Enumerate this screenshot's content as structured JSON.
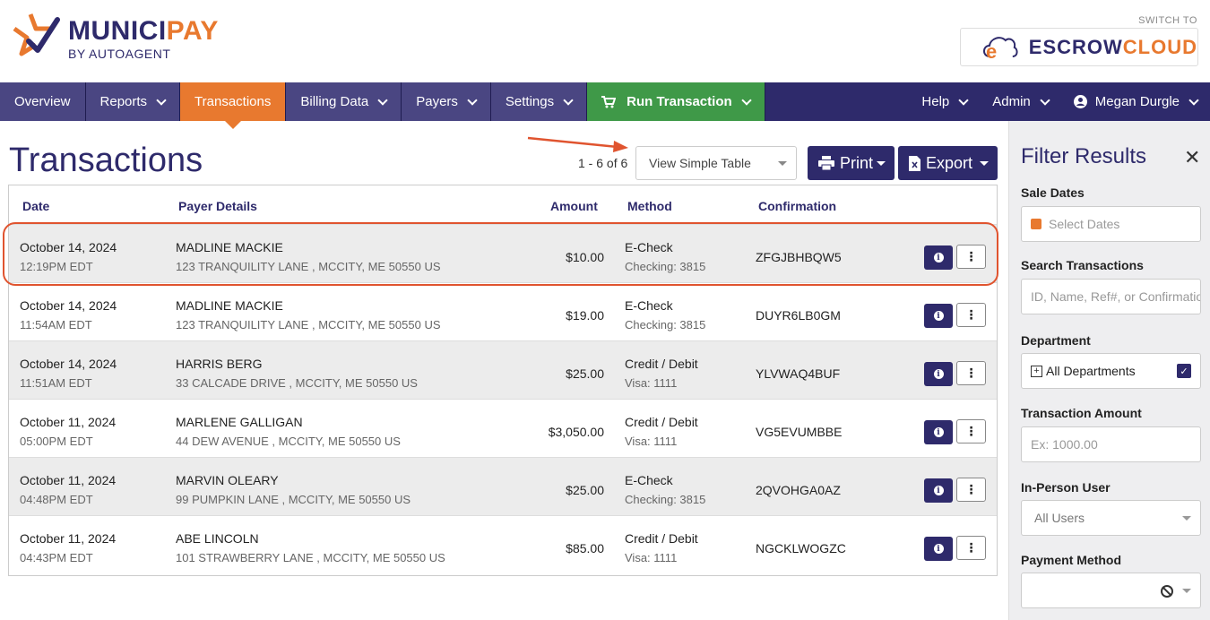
{
  "header": {
    "logo_main_a": "MUNICI",
    "logo_main_b": "PAY",
    "logo_sub": "BY AUTOAGENT",
    "switch_to": "SWITCH TO",
    "escrow_a": "ESCROW",
    "escrow_b": "CLOUD"
  },
  "nav": {
    "overview": "Overview",
    "reports": "Reports",
    "transactions": "Transactions",
    "billing": "Billing Data",
    "payers": "Payers",
    "settings": "Settings",
    "run": "Run Transaction",
    "help": "Help",
    "admin": "Admin",
    "user": "Megan Durgle"
  },
  "page": {
    "title": "Transactions",
    "count": "1 - 6 of 6",
    "view_select": "View Simple Table",
    "print": "Print",
    "export": "Export"
  },
  "table": {
    "headers": {
      "date": "Date",
      "payer": "Payer Details",
      "amount": "Amount",
      "method": "Method",
      "confirmation": "Confirmation"
    },
    "rows": [
      {
        "date": "October 14, 2024",
        "time": "12:19PM EDT",
        "name": "MADLINE MACKIE",
        "address": "123 TRANQUILITY LANE , MCCITY, ME 50550 US",
        "amount": "$10.00",
        "method": "E-Check",
        "method_detail": "Checking: 3815",
        "confirmation": "ZFGJBHBQW5"
      },
      {
        "date": "October 14, 2024",
        "time": "11:54AM EDT",
        "name": "MADLINE MACKIE",
        "address": "123 TRANQUILITY LANE , MCCITY, ME 50550 US",
        "amount": "$19.00",
        "method": "E-Check",
        "method_detail": "Checking: 3815",
        "confirmation": "DUYR6LB0GM"
      },
      {
        "date": "October 14, 2024",
        "time": "11:51AM EDT",
        "name": "HARRIS BERG",
        "address": "33 CALCADE DRIVE , MCCITY, ME 50550 US",
        "amount": "$25.00",
        "method": "Credit / Debit",
        "method_detail": "Visa: 1111",
        "confirmation": "YLVWAQ4BUF"
      },
      {
        "date": "October 11, 2024",
        "time": "05:00PM EDT",
        "name": "MARLENE GALLIGAN",
        "address": "44 DEW AVENUE , MCCITY, ME 50550 US",
        "amount": "$3,050.00",
        "method": "Credit / Debit",
        "method_detail": "Visa: 1111",
        "confirmation": "VG5EVUMBBE"
      },
      {
        "date": "October 11, 2024",
        "time": "04:48PM EDT",
        "name": "MARVIN OLEARY",
        "address": "99 PUMPKIN LANE , MCCITY, ME 50550 US",
        "amount": "$25.00",
        "method": "E-Check",
        "method_detail": "Checking: 3815",
        "confirmation": "2QVOHGA0AZ"
      },
      {
        "date": "October 11, 2024",
        "time": "04:43PM EDT",
        "name": "ABE LINCOLN",
        "address": "101 STRAWBERRY LANE , MCCITY, ME 50550 US",
        "amount": "$85.00",
        "method": "Credit / Debit",
        "method_detail": "Visa: 1111",
        "confirmation": "NGCKLWOGZC"
      }
    ],
    "more_glyph": "⋮",
    "info_glyph": "i"
  },
  "sidebar": {
    "title": "Filter Results",
    "close": "✕",
    "sale_dates_label": "Sale Dates",
    "sale_dates_placeholder": "Select Dates",
    "search_label": "Search Transactions",
    "search_placeholder": "ID, Name, Ref#, or Confirmation",
    "department_label": "Department",
    "department_value": "All Departments",
    "department_check": "✓",
    "amount_label": "Transaction Amount",
    "amount_placeholder": "Ex: 1000.00",
    "user_label": "In-Person User",
    "user_value": "All Users",
    "payment_label": "Payment Method"
  },
  "colors": {
    "brand_navy": "#2e2a6b",
    "brand_orange": "#e8792f",
    "run_green": "#3f9948",
    "highlight_red": "#e0542f"
  }
}
